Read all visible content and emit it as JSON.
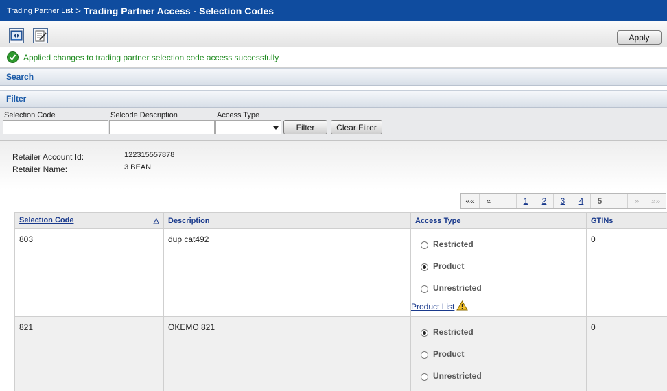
{
  "header": {
    "breadcrumb_link": "Trading Partner List",
    "separator": ">",
    "title": "Trading Partner Access - Selection Codes"
  },
  "toolbar": {
    "apply_label": "Apply",
    "icons": [
      "collapse-panel-icon",
      "edit-document-icon"
    ]
  },
  "message": {
    "text": "Applied changes to trading partner selection code access successfully"
  },
  "sections": {
    "search": "Search",
    "filter": "Filter"
  },
  "filter": {
    "selection_code_label": "Selection Code",
    "selcode_description_label": "Selcode Description",
    "access_type_label": "Access Type",
    "selection_code_value": "",
    "selcode_description_value": "",
    "access_type_value": "",
    "filter_button": "Filter",
    "clear_button": "Clear Filter"
  },
  "retailer": {
    "account_id_label": "Retailer Account Id:",
    "account_id_value": "122315557878",
    "name_label": "Retailer Name:",
    "name_value": "3 BEAN"
  },
  "pager": {
    "first": "««",
    "prev": "«",
    "pages": [
      "1",
      "2",
      "3",
      "4"
    ],
    "current": "5",
    "next": "»",
    "last": "»»"
  },
  "table": {
    "columns": [
      "Selection Code",
      "Description",
      "Access Type",
      "GTINs"
    ],
    "sort_indicator": "△",
    "access_options": [
      "Restricted",
      "Product",
      "Unrestricted"
    ],
    "product_list_label": "Product List",
    "rows": [
      {
        "code": "803",
        "description": "dup cat492",
        "access": "Product",
        "gtins": "0",
        "show_product_list": true
      },
      {
        "code": "821",
        "description": "OKEMO 821",
        "access": "Restricted",
        "gtins": "0",
        "show_product_list": false
      }
    ]
  },
  "colors": {
    "title_bar": "#0f4c9f",
    "success_text": "#1e8a1e",
    "section_header_text": "#1a5aa8",
    "link": "#1a3a8c"
  }
}
